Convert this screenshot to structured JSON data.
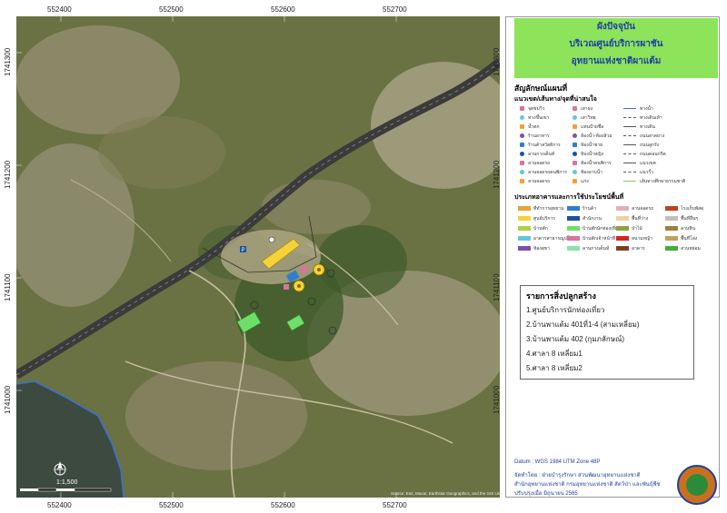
{
  "title": {
    "line1": "ผังปัจจุบัน",
    "line2": "บริเวณศูนย์บริการผาชัน",
    "line3": "อุทยานแห่งชาติผาแต้ม"
  },
  "grid": {
    "x_labels": [
      "552400",
      "552500",
      "552600",
      "552700"
    ],
    "y_labels": [
      "1741300",
      "1741200",
      "1741100",
      "1741000"
    ]
  },
  "legend": {
    "heading": "สัญลักษณ์แผนที่",
    "subheading": "แนวเขต/เส้นทาง/จุดที่น่าสนใจ",
    "points_col1": [
      "จุดชมวิว",
      "ทางขึ้นเขา",
      "น้ำตก",
      "ร้านอาหาร",
      "ร้านค้าสวัสดิการ",
      "ลานกางเต็นท์",
      "ลานจอดรถ",
      "ลานจอดรถคนพิการ",
      "ลานจอดรถ"
    ],
    "points_col2": [
      "เสาธง",
      "เสาวิทยุ",
      "แท่นป้ายชื่อ",
      "ห้องน้ำ-ห้องส้วม",
      "ห้องน้ำชาย",
      "ห้องน้ำหญิง",
      "ห้องน้ำคนพิการ",
      "ห้องอาบน้ำ",
      "แก่ง"
    ],
    "lines_col3": [
      "ทางน้ำ",
      "ทางเดินเท้า",
      "ทางเดิน",
      "ถนนลาดยาง",
      "ถนนลูกรัง",
      "ถนนคอนกรีต",
      "แนวเขต",
      "แนวรั้ว",
      "เส้นทางศึกษาธรรมชาติ"
    ],
    "landuse_heading": "ประเภทอาคารและการใช้ประโยชน์พื้นที่",
    "landuse": [
      {
        "label": "ที่ทำการอุทยาน",
        "color": "#e8a33a"
      },
      {
        "label": "ศูนย์บริการ",
        "color": "#f5d23a"
      },
      {
        "label": "บ้านพัก",
        "color": "#b0d040"
      },
      {
        "label": "อาคารสาธารณูปโภค",
        "color": "#5fc8e0"
      },
      {
        "label": "ห้องสุขา",
        "color": "#7f4fb0"
      },
      {
        "label": "ร้านค้า",
        "color": "#2f7fd0"
      },
      {
        "label": "สำนักงาน",
        "color": "#1f4fa0"
      },
      {
        "label": "บ้านพักนักท่องเที่ยว",
        "color": "#6ee06a"
      },
      {
        "label": "บ้านพักเจ้าหน้าที่",
        "color": "#e070a0"
      },
      {
        "label": "ลานกางเต็นท์",
        "color": "#8fe0b0"
      },
      {
        "label": "ลานจอดรถ",
        "color": "#e0b0c0"
      },
      {
        "label": "พื้นที่ว่าง",
        "color": "#f0d0a0"
      },
      {
        "label": "ป่าไม้",
        "color": "#90a040"
      },
      {
        "label": "สนามหญ้า",
        "color": "#e02020"
      },
      {
        "label": "อาคาร",
        "color": "#7f3f1f"
      },
      {
        "label": "โรงเก็บพัสดุ",
        "color": "#c04020"
      },
      {
        "label": "พื้นที่อื่นๆ",
        "color": "#c0c0c0"
      },
      {
        "label": "ลานหิน",
        "color": "#a08040"
      },
      {
        "label": "พื้นที่โล่ง",
        "color": "#c0a060"
      },
      {
        "label": "สวนหย่อม",
        "color": "#40b040"
      }
    ]
  },
  "buildings": {
    "heading": "รายการสิ่งปลูกสร้าง",
    "items": [
      "1.ศูนย์บริการนักท่องเที่ยว",
      "2.บ้านพาแต้ม 401ที่1-4 (สามเหลี่ยม)",
      "3.บ้านพาแต้ม 402 (กุมภลักษณ์)",
      "4.ศาลา 8 เหลี่ยม1",
      "5.ศาลา 8 เหลี่ยม2"
    ]
  },
  "scale_label": "1:1,500",
  "credits": {
    "datum": "Datum : WGS 1984 UTM Zone 48P",
    "made_by": "จัดทำโดย : ฝ่ายบำรุงรักษา ส่วนพัฒนาอุทยานแห่งชาติ",
    "office": "สำนักอุทยานแห่งชาติ กรมอุทยานแห่งชาติ สัตว์ป่า และพันธุ์พืช",
    "updated": "ปรับปรุงเมื่อ มิถุนายน 2565"
  },
  "imagery_attribution": "Source: Esri, Maxar, Earthstar Geographics, and the GIS User Community"
}
